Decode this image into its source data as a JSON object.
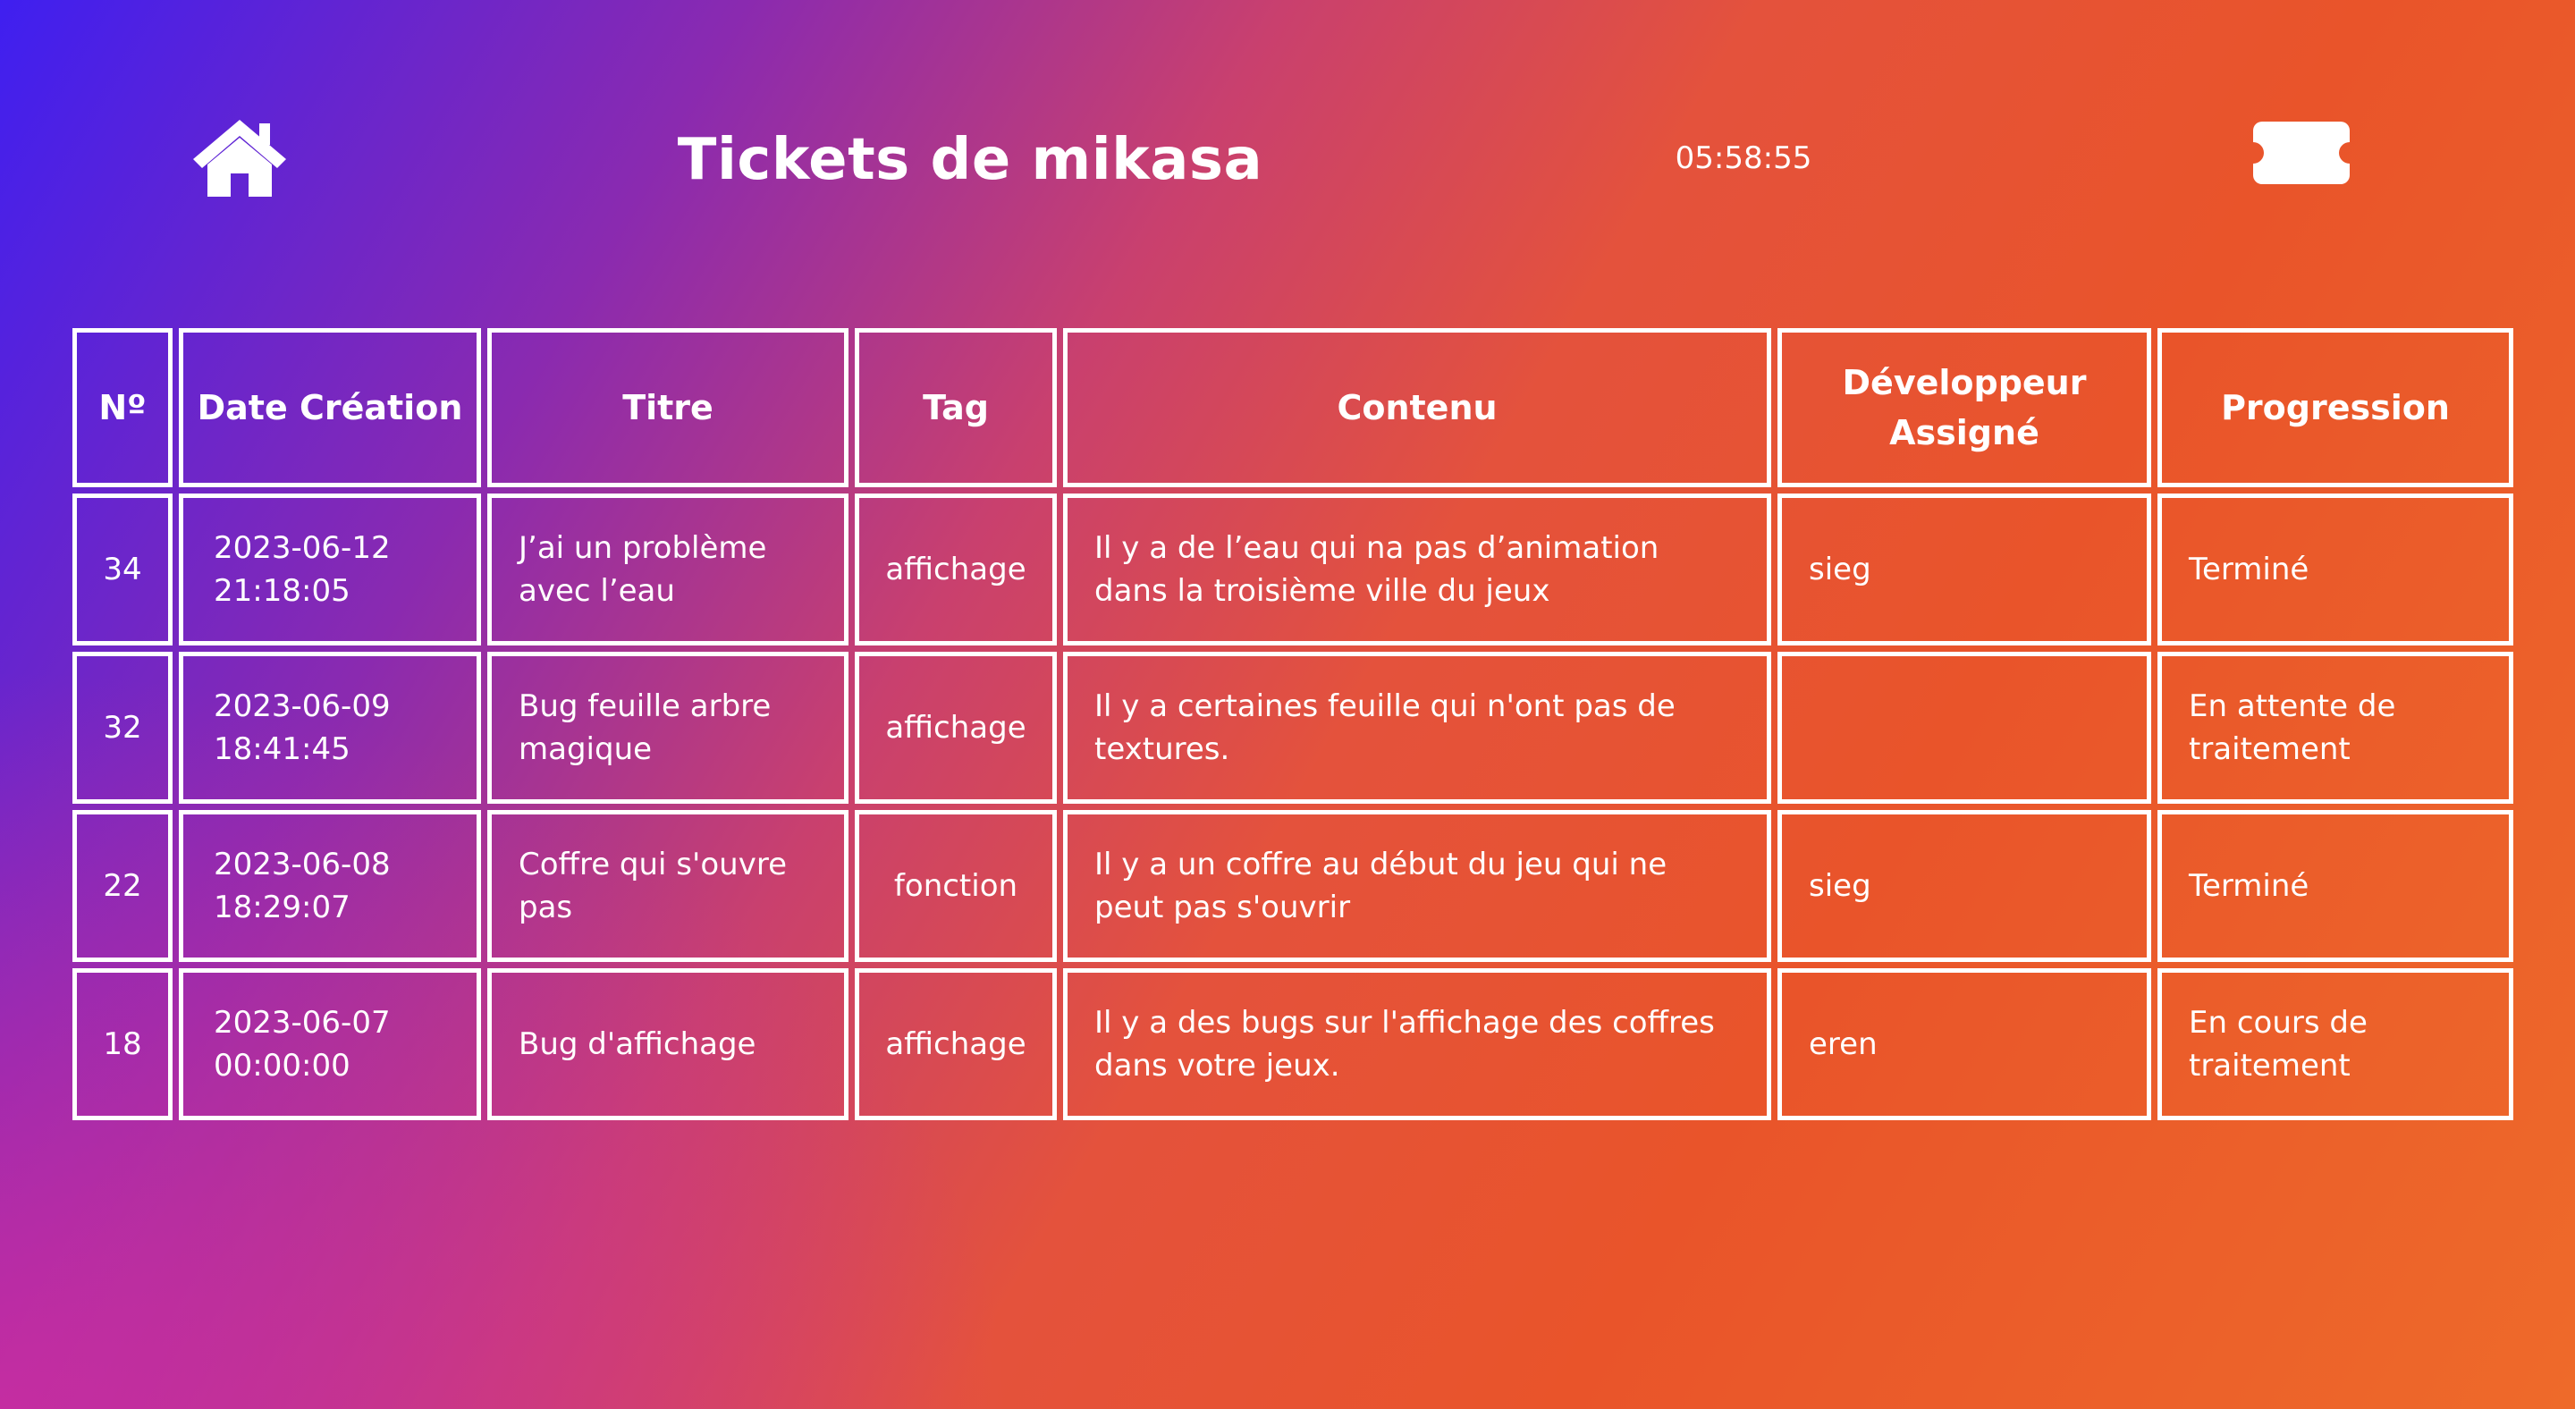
{
  "header": {
    "home_icon": "home-icon",
    "title": "Tickets de mikasa",
    "time": "05:58:55",
    "ticket_icon": "ticket-icon"
  },
  "colors": {
    "gradient_start": "#3f1ff0",
    "gradient_mid": "#c9406e",
    "gradient_end": "#ee6a2a",
    "text": "#ffffff",
    "border": "#ffffff"
  },
  "table": {
    "headers": [
      "Nº",
      "Date Création",
      "Titre",
      "Tag",
      "Contenu",
      "Développeur Assigné",
      "Progression"
    ],
    "rows": [
      {
        "num": "34",
        "date": "2023-06-12 21:18:05",
        "title": "J’ai un problème avec l’eau",
        "tag": "affichage",
        "content": "Il y a de l’eau qui na pas d’animation dans la troisième ville du jeux",
        "developer": "sieg",
        "progress": "Terminé"
      },
      {
        "num": "32",
        "date": "2023-06-09 18:41:45",
        "title": "Bug feuille arbre magique",
        "tag": "affichage",
        "content": "Il y a certaines feuille qui n'ont pas de textures.",
        "developer": "",
        "progress": "En attente de traitement"
      },
      {
        "num": "22",
        "date": "2023-06-08 18:29:07",
        "title": "Coffre qui s'ouvre pas",
        "tag": "fonction",
        "content": "Il y a un coffre au début du jeu qui ne peut pas s'ouvrir",
        "developer": "sieg",
        "progress": "Terminé"
      },
      {
        "num": "18",
        "date": "2023-06-07 00:00:00",
        "title": "Bug d'affichage",
        "tag": "affichage",
        "content": "Il y a des bugs sur l'affichage des coffres dans votre jeux.",
        "developer": "eren",
        "progress": "En cours de traitement"
      }
    ]
  }
}
